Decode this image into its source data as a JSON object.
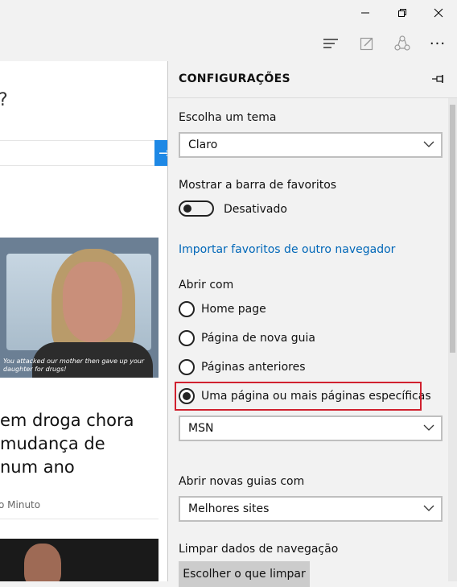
{
  "window": {
    "controls": {
      "minimize_icon": "minimize-icon",
      "maximize_icon": "restore-icon",
      "close_icon": "close-icon"
    }
  },
  "toolbar": {
    "icons": [
      "hub-icon",
      "web-note-icon",
      "share-icon",
      "more-icon"
    ],
    "more_label": "···"
  },
  "page": {
    "question_fragment": "?",
    "search_button_glyph": "→",
    "article": {
      "image_caption": "You attacked our mother then gave up your daughter for drugs!",
      "headline_lines": [
        "em droga chora",
        "mudança de",
        "num ano"
      ],
      "source": "o Minuto"
    }
  },
  "settings": {
    "title": "CONFIGURAÇÕES",
    "theme": {
      "label": "Escolha um tema",
      "value": "Claro"
    },
    "favorites_bar": {
      "label": "Mostrar a barra de favoritos",
      "state_label": "Desativado",
      "on": false
    },
    "import_link": "Importar favoritos de outro navegador",
    "open_with": {
      "label": "Abrir com",
      "options": [
        {
          "label": "Home page",
          "selected": false
        },
        {
          "label": "Página de nova guia",
          "selected": false
        },
        {
          "label": "Páginas anteriores",
          "selected": false
        },
        {
          "label": "Uma página ou mais páginas específicas",
          "selected": true
        }
      ],
      "specific_page_value": "MSN"
    },
    "new_tabs": {
      "label": "Abrir novas guias com",
      "value": "Melhores sites"
    },
    "clear_data": {
      "label": "Limpar dados de navegação",
      "button_label": "Escolher o que limpar"
    },
    "colors": {
      "link": "#0067b8",
      "highlight_border": "#d0202e",
      "accent": "#1e88e5"
    }
  }
}
